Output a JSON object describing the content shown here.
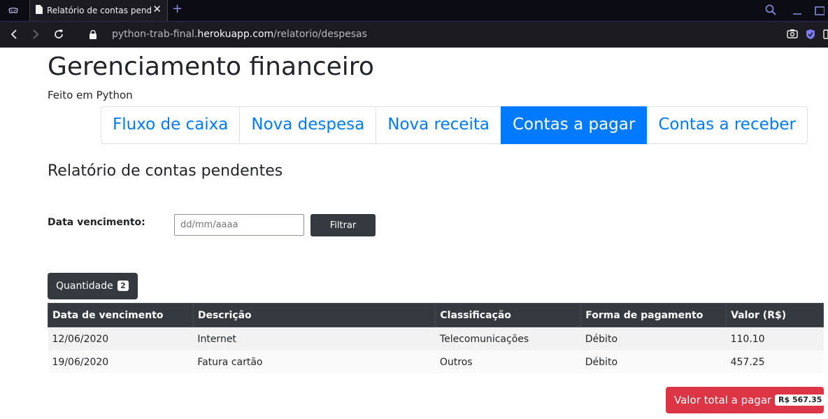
{
  "browser": {
    "tab_title": "Relatório de contas pendentes",
    "tab_close": "✕",
    "new_tab": "+",
    "url_prefix": "python-trab-final.",
    "url_domain": "herokuapp.com",
    "url_path": "/relatorio/despesas"
  },
  "header": {
    "title": "Gerenciamento financeiro",
    "subtitle": "Feito em Python"
  },
  "nav": {
    "items": [
      {
        "label": "Fluxo de caixa"
      },
      {
        "label": "Nova despesa"
      },
      {
        "label": "Nova receita"
      },
      {
        "label": "Contas a pagar",
        "active": true
      },
      {
        "label": "Contas a receber"
      }
    ]
  },
  "report": {
    "title": "Relatório de contas pendentes"
  },
  "filter": {
    "label": "Data vencimento:",
    "placeholder": "dd/mm/aaaa",
    "button": "Filtrar"
  },
  "quantity": {
    "label": "Quantidade",
    "count": "2"
  },
  "table": {
    "headers": [
      "Data de vencimento",
      "Descrição",
      "Classificação",
      "Forma de pagamento",
      "Valor (R$)"
    ],
    "rows": [
      [
        "12/06/2020",
        "Internet",
        "Telecomunicações",
        "Débito",
        "110.10"
      ],
      [
        "19/06/2020",
        "Fatura cartão",
        "Outros",
        "Débito",
        "457.25"
      ]
    ]
  },
  "total": {
    "label": "Valor total a pagar",
    "value": "R$ 567.35"
  },
  "colors": {
    "primary": "#007bff",
    "dark": "#343a40",
    "danger": "#dc3545"
  }
}
